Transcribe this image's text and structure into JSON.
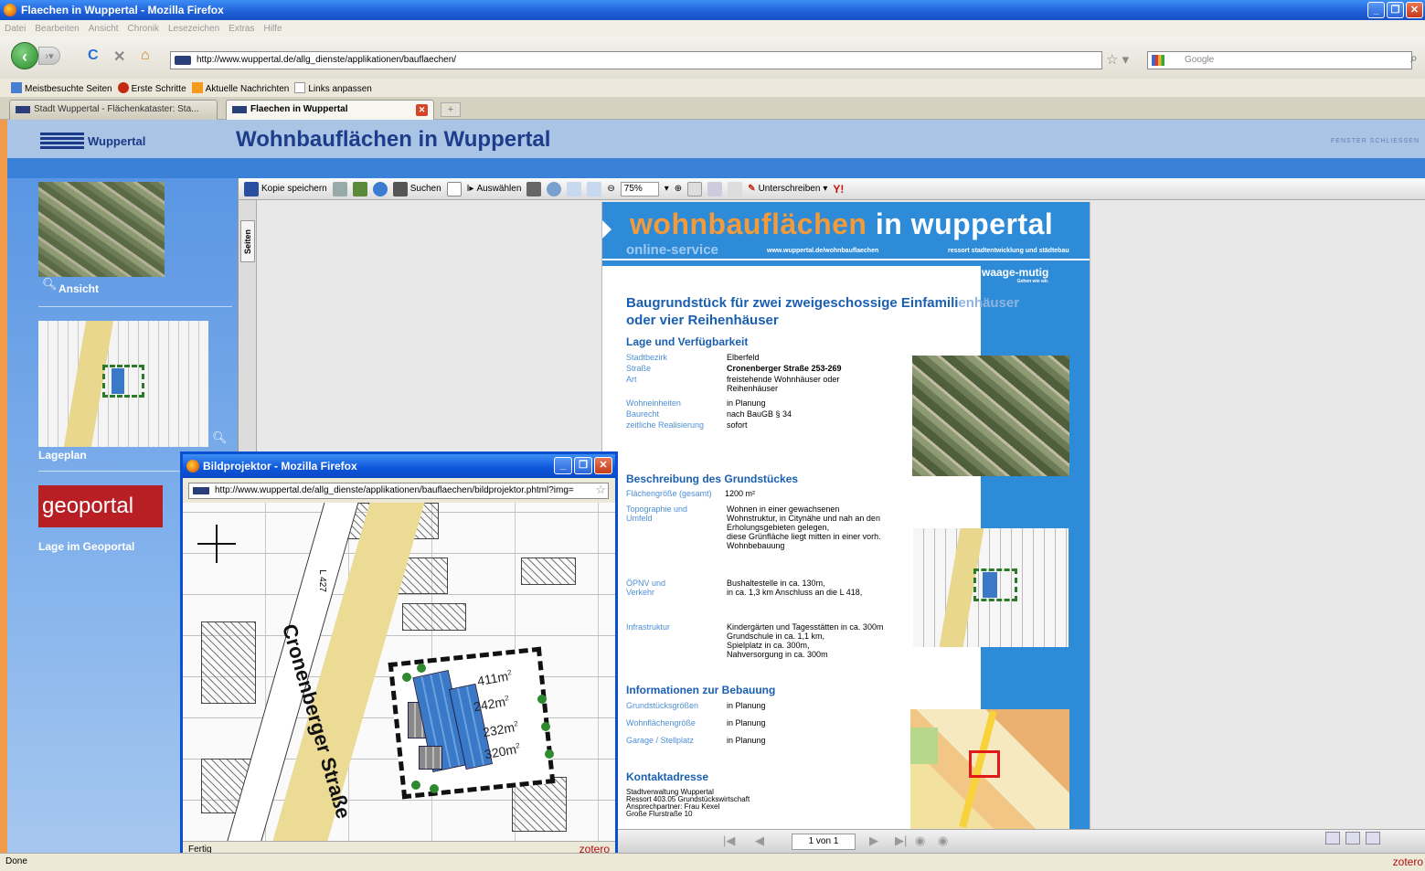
{
  "window": {
    "title": "Flaechen in Wuppertal - Mozilla Firefox",
    "controls": [
      "_",
      "❐",
      "✕"
    ]
  },
  "menu": [
    "Datei",
    "Bearbeiten",
    "Ansicht",
    "Chronik",
    "Lesezeichen",
    "Extras",
    "Hilfe"
  ],
  "nav": {
    "url": "http://www.wuppertal.de/allg_dienste/applikationen/bauflaechen/",
    "search_placeholder": "Google"
  },
  "bookmarks": [
    "Meistbesuchte Seiten",
    "Erste Schritte",
    "Aktuelle Nachrichten",
    "Links anpassen"
  ],
  "tabs": [
    {
      "label": "Stadt Wuppertal - Flächenkataster: Sta..."
    },
    {
      "label": "Flaechen in Wuppertal"
    }
  ],
  "site": {
    "logo_text": "Wuppertal",
    "title": "Wohnbauflächen in Wuppertal",
    "fenster": "FENSTER SCHLIESSEN"
  },
  "sidebar": {
    "ansicht": "Ansicht",
    "lageplan": "Lageplan",
    "geoportal_logo": "geoportal",
    "geoportal_link": "Lage im Geoportal"
  },
  "pdf_toolbar": {
    "save": "Kopie speichern",
    "search": "Suchen",
    "select": "Auswählen",
    "zoom": "75%",
    "sign": "Unterschreiben",
    "pages_tab": "Seiten"
  },
  "pdf_nav": {
    "page": "1 von 1"
  },
  "doc": {
    "h1_a": "wohnbauflächen",
    "h1_b": "in wuppertal",
    "online": "online-service",
    "url": "www.wuppertal.de/wohnbauflaechen",
    "ressort": "ressort stadtentwicklung und städtebau",
    "waage": "waage-mutig",
    "waage_sub": "Gehen wie wir.",
    "title_line1": "Baugrundstück für zwei zweigeschossige Einfamili",
    "title_line1_fade": "enhäuser",
    "title_line2": "oder vier Reihenhäuser",
    "sec_lage": "Lage und Verfügbarkeit",
    "lage": [
      {
        "k": "Stadtbezirk",
        "v": "Elberfeld"
      },
      {
        "k": "Straße",
        "v": "Cronenberger Straße 253-269"
      },
      {
        "k": "Art",
        "v": "freistehende Wohnhäuser oder"
      },
      {
        "k": "",
        "v": "Reihenhäuser"
      },
      {
        "k": "Wohneinheiten",
        "v": "in Planung"
      },
      {
        "k": "Baurecht",
        "v": "nach BauGB § 34"
      },
      {
        "k": "zeitliche Realisierung",
        "v": "sofort"
      }
    ],
    "sec_beschreibung": "Beschreibung des Grundstückes",
    "flaeche_k": "Flächengröße (gesamt)",
    "flaeche_v": "1200 m²",
    "topo_k1": "Topographie und",
    "topo_k2": "Umfeld",
    "topo_v": [
      "Wohnen in einer gewachsenen",
      "Wohnstruktur, in Citynähe und nah an den",
      "Erholungsgebieten gelegen,",
      "diese Grünfläche liegt mitten in einer vorh.",
      "Wohnbebauung"
    ],
    "oepnv_k1": "ÖPNV und",
    "oepnv_k2": "Verkehr",
    "oepnv_v": [
      "Bushaltestelle in ca. 130m,",
      "in ca. 1,3 km Anschluss an die L 418,"
    ],
    "infra_k": "Infrastruktur",
    "infra_v": [
      "Kindergärten und Tagesstätten in ca. 300m",
      "Grundschule in ca. 1,1 km,",
      "Spielplatz in ca. 300m,",
      "Nahversorgung in ca. 300m"
    ],
    "sec_bebauung": "Informationen zur Bebauung",
    "bebauung": [
      {
        "k": "Grundstücksgrößen",
        "v": "in Planung"
      },
      {
        "k": "Wohnflächengröße",
        "v": "in Planung"
      },
      {
        "k": "Garage / Stellplatz",
        "v": "in Planung"
      }
    ],
    "sec_kontakt": "Kontaktadresse",
    "kontakt": [
      "Stadtverwaltung Wuppertal",
      "Ressort 403.05 Grundstückswirtschaft",
      "Ansprechpartner: Frau Kexel",
      "Große Flurstraße 10"
    ]
  },
  "popup": {
    "title": "Bildprojektor - Mozilla Firefox",
    "url": "http://www.wuppertal.de/allg_dienste/applikationen/bauflaechen/bildprojektor.phtml?img=",
    "street": "Cronenberger Straße",
    "road_code": "L 427",
    "areas": [
      "411m",
      "242m",
      "232m",
      "320m"
    ],
    "area_sup": "2",
    "status": "Fertig",
    "zotero": "zotero"
  },
  "status": {
    "text": "Done",
    "zotero": "zotero"
  }
}
